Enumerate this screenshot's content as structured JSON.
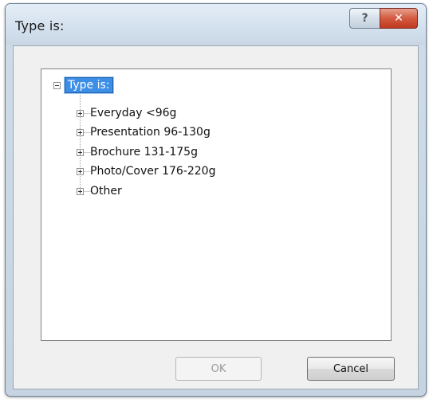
{
  "window": {
    "title": "Type is:",
    "help_glyph": "?",
    "close_glyph": "✕"
  },
  "tree": {
    "root": {
      "label": "Type is:",
      "expander": "minus",
      "selected": true
    },
    "children": [
      {
        "label": "Everyday <96g",
        "expander": "plus"
      },
      {
        "label": "Presentation 96-130g",
        "expander": "plus"
      },
      {
        "label": "Brochure 131-175g",
        "expander": "plus"
      },
      {
        "label": "Photo/Cover 176-220g",
        "expander": "plus"
      },
      {
        "label": "Other",
        "expander": "plus"
      }
    ]
  },
  "buttons": {
    "ok_label": "OK",
    "ok_enabled": false,
    "cancel_label": "Cancel"
  },
  "colors": {
    "selection": "#3d8ee6",
    "close_button": "#d35a3f"
  }
}
